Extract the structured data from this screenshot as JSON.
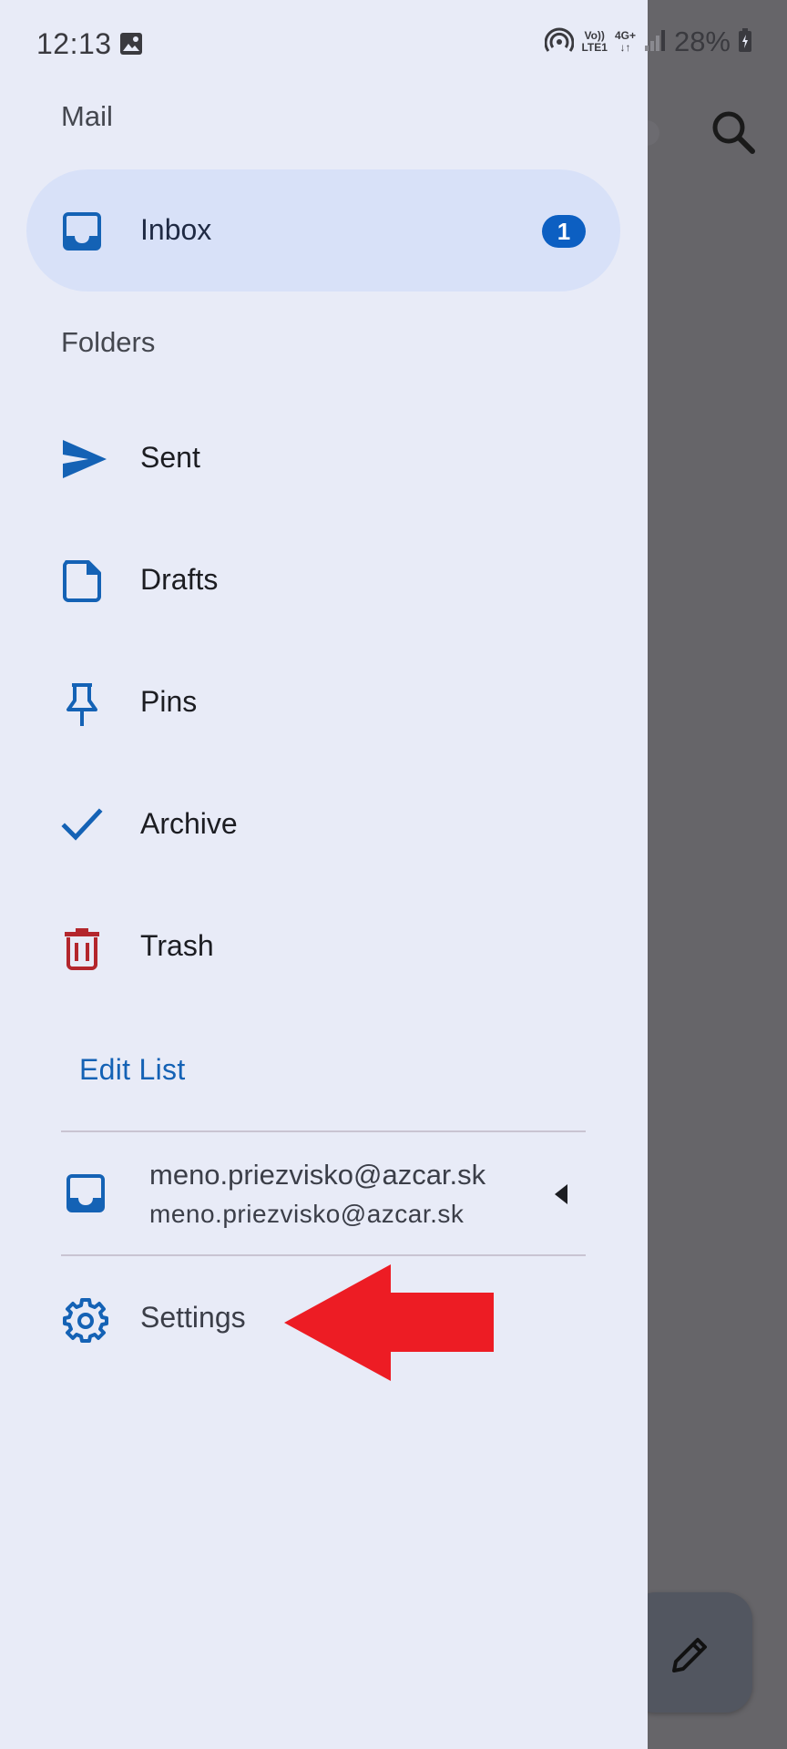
{
  "status_bar": {
    "time": "12:13",
    "network_top": "Vo))",
    "network_bottom": "LTE1",
    "network_type": "4G+",
    "battery": "28%"
  },
  "drawer": {
    "mail_header": "Mail",
    "inbox": {
      "label": "Inbox",
      "badge": "1",
      "icon": "inbox-icon"
    },
    "folders_header": "Folders",
    "folders": [
      {
        "label": "Sent",
        "icon": "send-icon",
        "color": "#1462b5"
      },
      {
        "label": "Drafts",
        "icon": "draft-icon",
        "color": "#1462b5"
      },
      {
        "label": "Pins",
        "icon": "pin-icon",
        "color": "#1462b5"
      },
      {
        "label": "Archive",
        "icon": "check-icon",
        "color": "#1462b5"
      },
      {
        "label": "Trash",
        "icon": "trash-icon",
        "color": "#b3262c"
      }
    ],
    "edit_list": "Edit List",
    "account": {
      "name": "meno.priezvisko@azcar.sk",
      "email": "meno.priezvisko@azcar.sk"
    },
    "settings": "Settings"
  },
  "colors": {
    "accent": "#1462b5",
    "badge": "#0c5fc2",
    "drawer_bg": "#e8ebf7",
    "selected_bg": "#d8e1f8",
    "annotation_arrow": "#ed1c24"
  }
}
